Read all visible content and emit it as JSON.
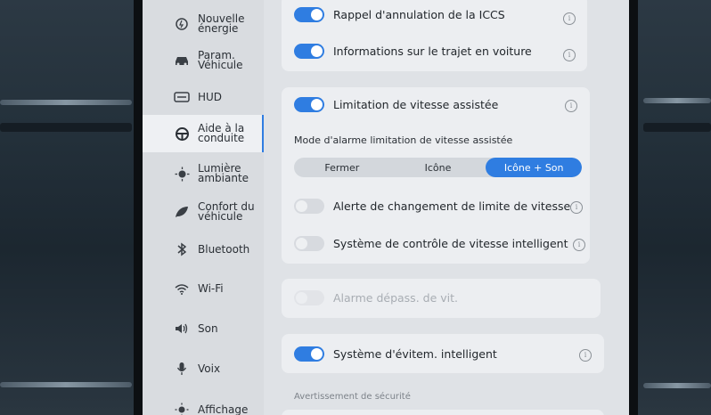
{
  "sidebar": {
    "items": [
      {
        "label": "Nouvelle énergie",
        "icon": "energy-icon"
      },
      {
        "label": "Param. Véhicule",
        "icon": "car-icon"
      },
      {
        "label": "HUD",
        "icon": "hud-icon"
      },
      {
        "label": "Aide à la conduite",
        "icon": "steering-wheel-icon",
        "active": true
      },
      {
        "label": "Lumière ambiante",
        "icon": "ambient-light-icon"
      },
      {
        "label": "Confort du véhicule",
        "icon": "leaf-icon"
      },
      {
        "label": "Bluetooth",
        "icon": "bluetooth-icon"
      },
      {
        "label": "Wi-Fi",
        "icon": "wifi-icon"
      },
      {
        "label": "Son",
        "icon": "speaker-icon"
      },
      {
        "label": "Voix",
        "icon": "microphone-icon"
      },
      {
        "label": "Affichage",
        "icon": "brightness-icon"
      }
    ]
  },
  "settings": {
    "iccs_reminder": {
      "label": "Rappel d'annulation de la ICCS",
      "enabled": true
    },
    "trip_info": {
      "label": "Informations sur le trajet en voiture",
      "enabled": true
    },
    "speed_limit_assist": {
      "label": "Limitation de vitesse assistée",
      "enabled": true
    },
    "alarm_mode": {
      "title": "Mode d'alarme limitation de vitesse assistée",
      "options": [
        "Fermer",
        "Icône",
        "Icône + Son"
      ],
      "selected": "Icône + Son"
    },
    "speed_limit_change_alert": {
      "label": "Alerte de changement de limite de vitesse",
      "enabled": false
    },
    "intelligent_speed_control": {
      "label": "Système de contrôle de vitesse intelligent",
      "enabled": false
    },
    "overspeed_alarm": {
      "label": "Alarme dépass. de vit.",
      "enabled": false,
      "disabled": true
    },
    "intelligent_avoidance": {
      "label": "Système d'évitem. intelligent",
      "enabled": true
    },
    "safety_warning_section": {
      "title": "Avertissement de sécurité"
    }
  },
  "colors": {
    "accent": "#2f7de1",
    "card": "#eceef1",
    "screen": "#dfe2e6"
  }
}
